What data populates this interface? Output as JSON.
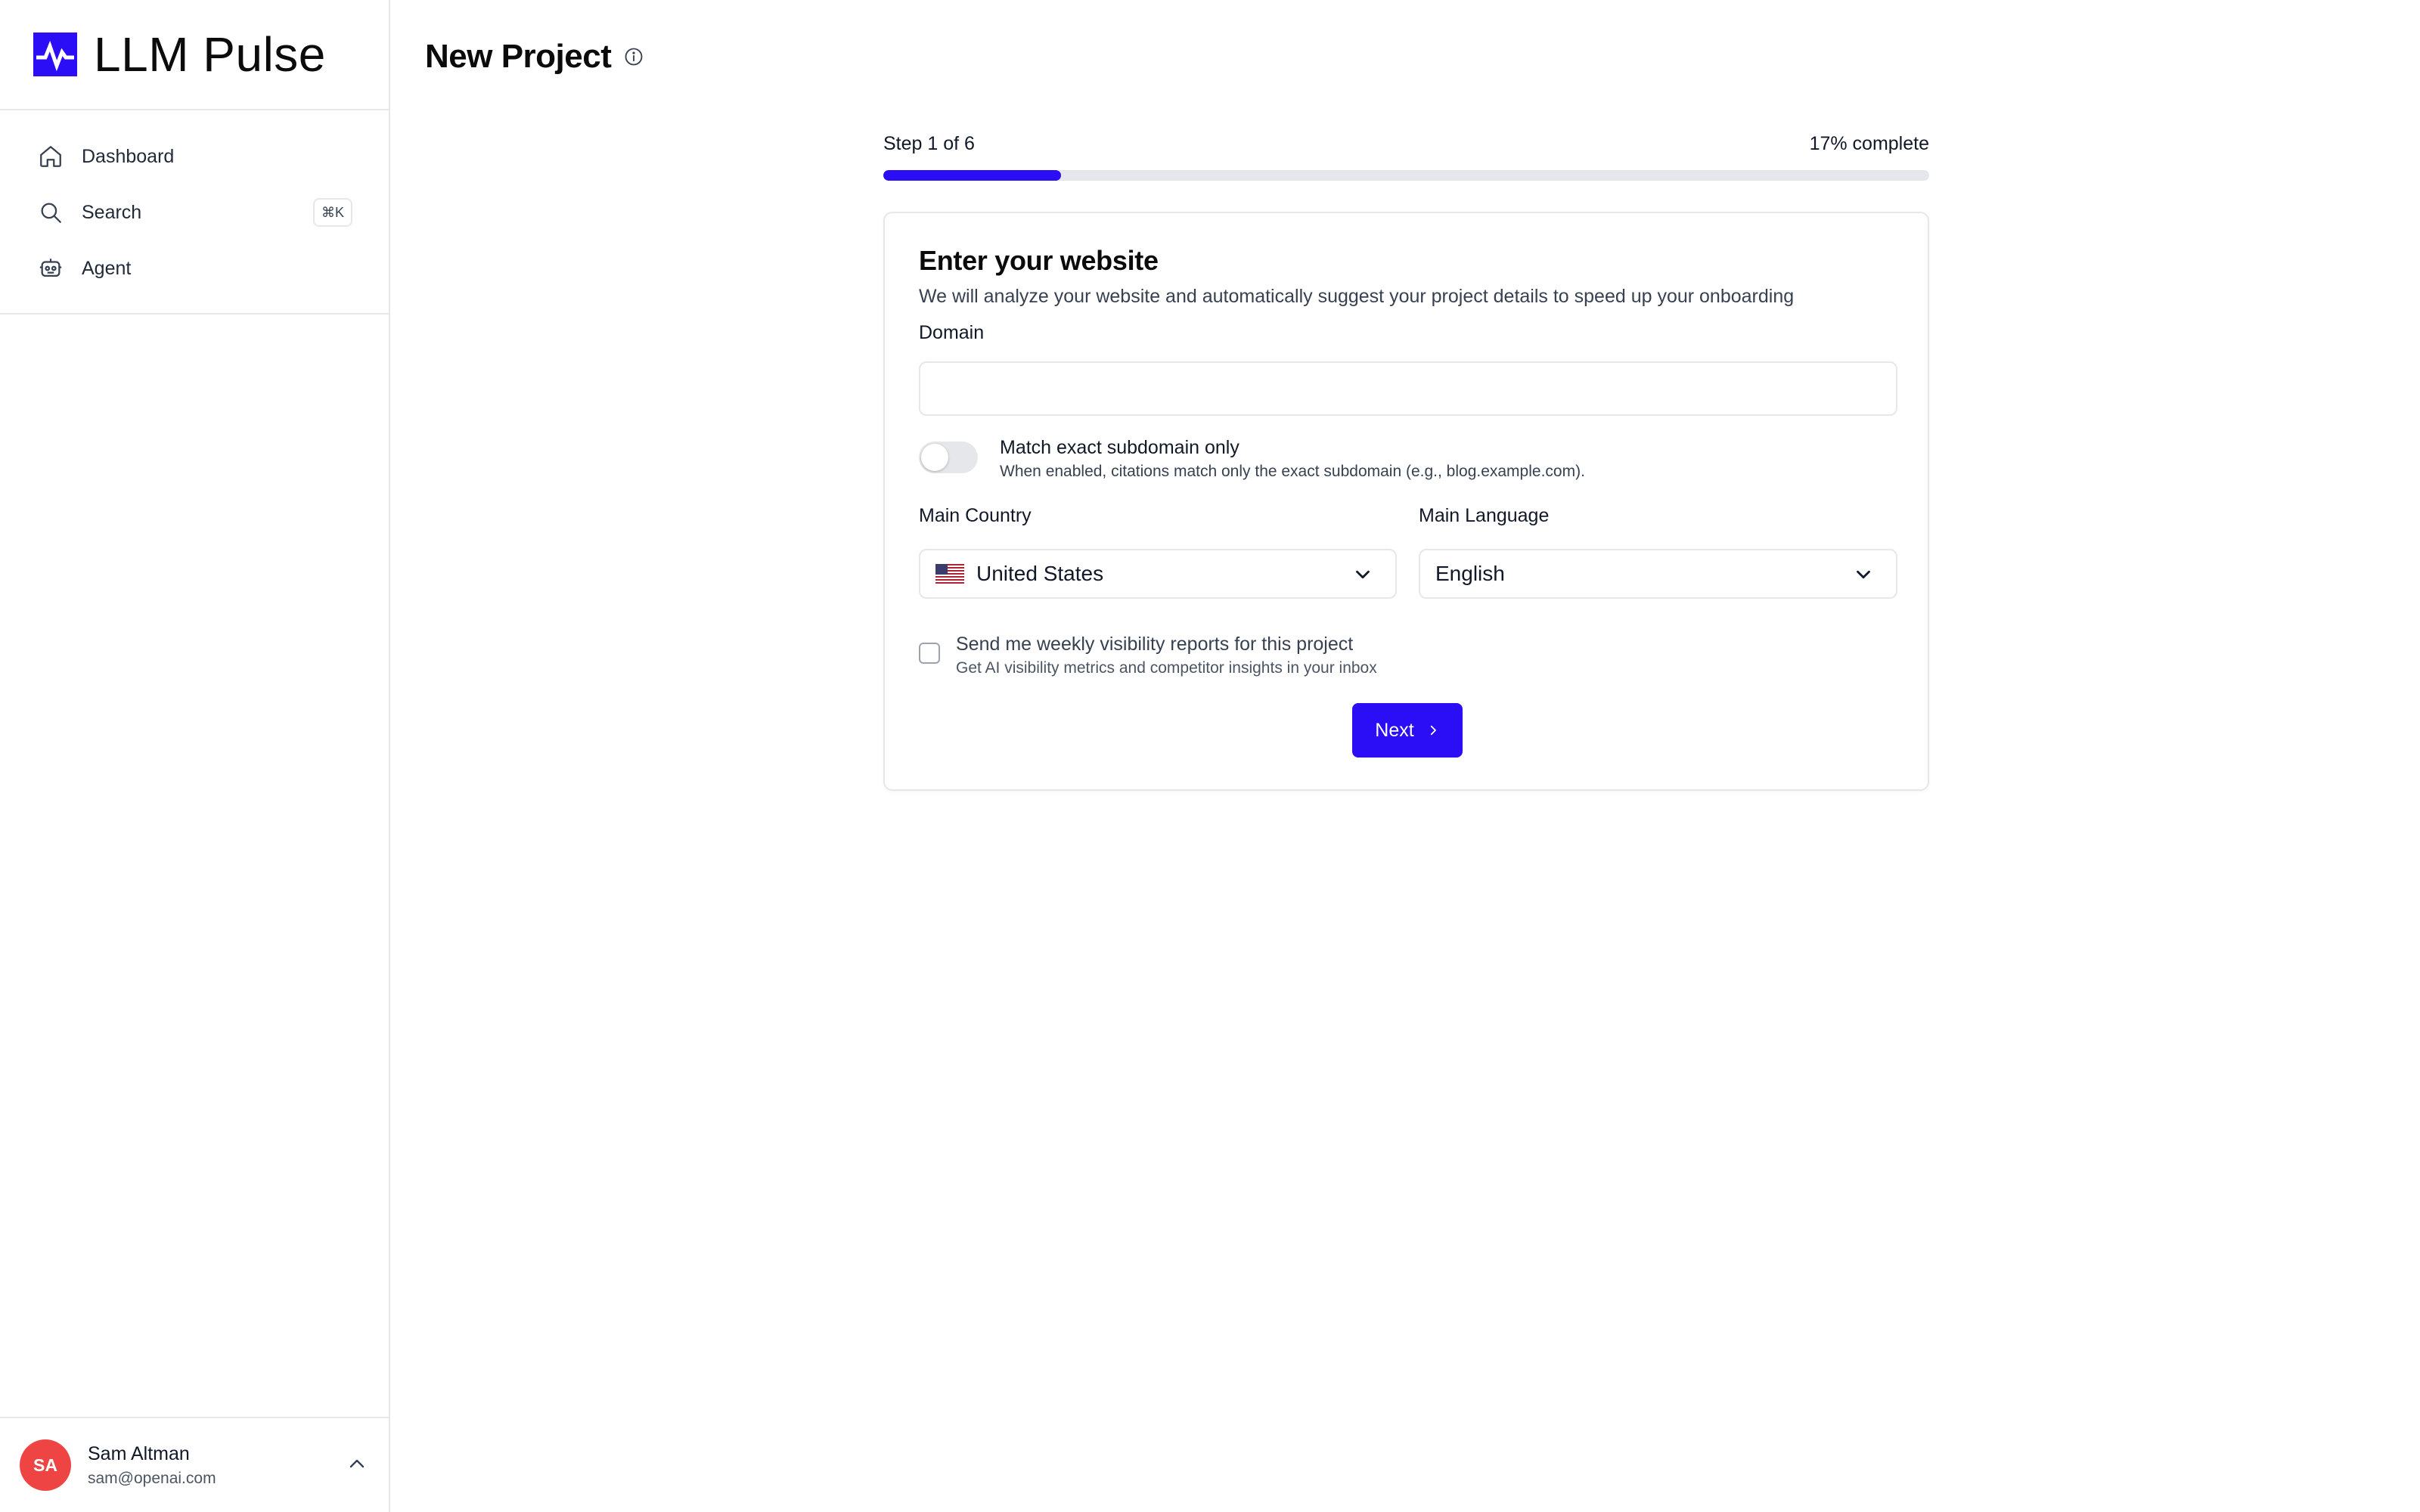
{
  "brand": {
    "name": "LLM Pulse",
    "logo_icon": "pulse-logo-icon",
    "accent": "#2b0ef5"
  },
  "sidebar": {
    "items": [
      {
        "label": "Dashboard",
        "icon": "home-icon"
      },
      {
        "label": "Search",
        "icon": "search-icon",
        "shortcut": "⌘K"
      },
      {
        "label": "Agent",
        "icon": "agent-icon"
      }
    ]
  },
  "user": {
    "initials": "SA",
    "name": "Sam Altman",
    "email": "sam@openai.com",
    "avatar_color": "#ef4444"
  },
  "page": {
    "title": "New Project"
  },
  "progress": {
    "step_text": "Step 1 of 6",
    "percent_text": "17% complete",
    "fraction": 0.17
  },
  "form": {
    "title": "Enter your website",
    "subtitle": "We will analyze your website and automatically suggest your project details to speed up your onboarding",
    "domain_label": "Domain",
    "domain_value": "",
    "domain_placeholder": "",
    "subdomain_toggle": {
      "label": "Match exact subdomain only",
      "help": "When enabled, citations match only the exact subdomain (e.g., blog.example.com).",
      "enabled": false
    },
    "country_label": "Main Country",
    "country_value": "United States",
    "language_label": "Main Language",
    "language_value": "English",
    "reports_checkbox": {
      "label": "Send me weekly visibility reports for this project",
      "help": "Get AI visibility metrics and competitor insights in your inbox",
      "checked": false
    },
    "next_label": "Next"
  }
}
